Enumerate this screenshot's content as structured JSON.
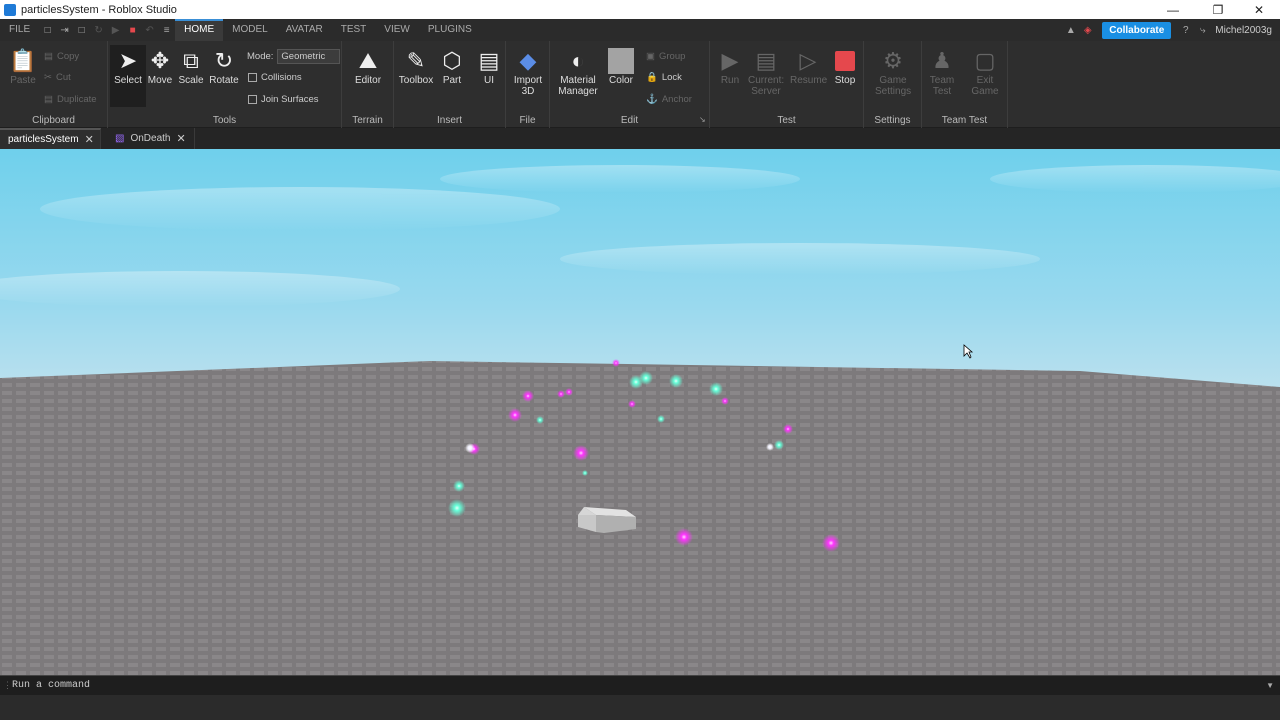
{
  "window": {
    "title": "particlesSystem - Roblox Studio"
  },
  "menubar": {
    "file": "FILE",
    "tabs": [
      "HOME",
      "MODEL",
      "AVATAR",
      "TEST",
      "VIEW",
      "PLUGINS"
    ],
    "active_tab": "HOME",
    "collaborate": "Collaborate",
    "user": "Michel2003g"
  },
  "ribbon": {
    "clipboard": {
      "label": "Clipboard",
      "paste": "Paste",
      "copy": "Copy",
      "cut": "Cut",
      "duplicate": "Duplicate"
    },
    "tools": {
      "label": "Tools",
      "select": "Select",
      "move": "Move",
      "scale": "Scale",
      "rotate": "Rotate",
      "mode_label": "Mode:",
      "mode_value": "Geometric",
      "collisions": "Collisions",
      "join_surfaces": "Join Surfaces"
    },
    "terrain": {
      "label": "Terrain",
      "editor": "Editor"
    },
    "insert": {
      "label": "Insert",
      "toolbox": "Toolbox",
      "part": "Part",
      "ui": "UI"
    },
    "file": {
      "label": "File",
      "import3d_line1": "Import",
      "import3d_line2": "3D"
    },
    "edit": {
      "label": "Edit",
      "material_line1": "Material",
      "material_line2": "Manager",
      "color": "Color",
      "group": "Group",
      "lock": "Lock",
      "anchor": "Anchor"
    },
    "test": {
      "label": "Test",
      "run": "Run",
      "current_line1": "Current:",
      "current_line2": "Server",
      "resume": "Resume",
      "stop": "Stop"
    },
    "settings": {
      "label": "Settings",
      "game_settings_line1": "Game",
      "game_settings_line2": "Settings"
    },
    "team_test": {
      "label": "Team Test",
      "team_test_line1": "Team",
      "team_test_line2": "Test",
      "exit_game_line1": "Exit",
      "exit_game_line2": "Game"
    }
  },
  "doc_tabs": [
    {
      "label": "particlesSystem",
      "active": true
    },
    {
      "label": "OnDeath",
      "active": false
    }
  ],
  "command_bar": {
    "placeholder": "Run a command"
  },
  "colors": {
    "accent": "#1a8fe3",
    "stop": "#e5484d",
    "particle_magenta": "#ff33ff",
    "particle_cyan": "#66ffd9"
  },
  "icons": [
    "select-icon",
    "move-icon",
    "scale-icon",
    "rotate-icon",
    "terrain-editor-icon",
    "toolbox-icon",
    "part-icon",
    "ui-icon",
    "import-3d-icon",
    "material-manager-icon",
    "color-swatch-icon",
    "run-icon",
    "current-server-icon",
    "resume-icon",
    "stop-icon",
    "game-settings-icon",
    "team-test-icon",
    "exit-game-icon"
  ]
}
